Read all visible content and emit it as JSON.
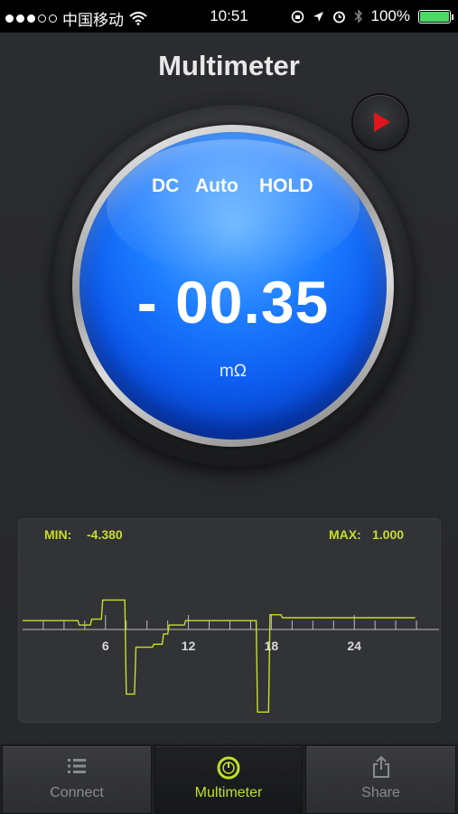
{
  "status_bar": {
    "carrier": "中国移动",
    "time": "10:51",
    "battery": "100%"
  },
  "title": "Multimeter",
  "play_icon": "play-icon",
  "display": {
    "mode_1": "DC",
    "mode_2": "Auto",
    "mode_3": "HOLD",
    "reading": "- 00.35",
    "unit": "mΩ"
  },
  "chart": {
    "min_label": "MIN:",
    "min_value": "-4.380",
    "max_label": "MAX:",
    "max_value": "1.000",
    "line_color": "#c8dd2a"
  },
  "chart_data": {
    "type": "line",
    "title": "",
    "xlabel": "",
    "ylabel": "",
    "x_ticks": [
      "6",
      "12",
      "18",
      "24"
    ],
    "series": [
      {
        "x": [
          0,
          4.0,
          4.1,
          4.9,
          5.0,
          5.7,
          5.8,
          6.5,
          6.6,
          7.4,
          7.5,
          8.1,
          8.2,
          9.4,
          9.5,
          10.1,
          10.2,
          10.5,
          10.6,
          11.7,
          11.8,
          16.9,
          17.0,
          17.8,
          17.9,
          18.7,
          18.8,
          20.1,
          20.2,
          28.4
        ],
        "y": [
          0.6,
          0.6,
          0.3,
          0.3,
          0.7,
          0.7,
          2.0,
          2.0,
          2.0,
          2.0,
          -4.38,
          -4.38,
          -1.2,
          -1.2,
          -1.0,
          -1.0,
          -0.3,
          -0.3,
          0.3,
          0.3,
          0.6,
          0.6,
          -5.6,
          -5.6,
          1.0,
          1.0,
          0.8,
          0.8,
          0.8,
          0.8
        ]
      }
    ],
    "grid": false
  },
  "tabs": [
    {
      "label": "Connect",
      "icon": "list-icon"
    },
    {
      "label": "Multimeter",
      "icon": "gauge-icon"
    },
    {
      "label": "Share",
      "icon": "share-icon"
    }
  ]
}
